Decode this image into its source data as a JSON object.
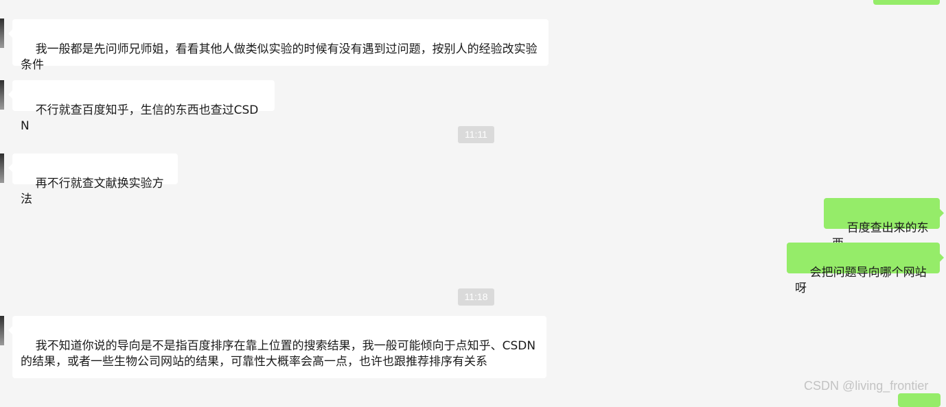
{
  "chat": {
    "messages": [
      {
        "side": "left",
        "text": "我一般都是先问师兄师姐，看看其他人做类似实验的时候有没有遇到过问题，按别人的经验改实验条件"
      },
      {
        "side": "left",
        "text": "不行就查百度知乎，生信的东西也查过CSDN"
      },
      {
        "type": "time",
        "text": "11:11"
      },
      {
        "side": "left",
        "text": "再不行就查文献换实验方法"
      },
      {
        "side": "right",
        "text": "百度查出来的东西"
      },
      {
        "side": "right",
        "text": "会把问题导向哪个网站呀"
      },
      {
        "type": "time",
        "text": "11:18"
      },
      {
        "side": "left",
        "text": "我不知道你说的导向是不是指百度排序在靠上位置的搜索结果，我一般可能倾向于点知乎、CSDN的结果，或者一些生物公司网站的结果，可靠性大概率会高一点，也许也跟推荐排序有关系"
      }
    ]
  },
  "watermark": "CSDN @living_frontier",
  "colors": {
    "background": "#f5f5f5",
    "incoming_bubble": "#ffffff",
    "outgoing_bubble": "#95ec69",
    "timestamp_bg": "#dadada"
  }
}
